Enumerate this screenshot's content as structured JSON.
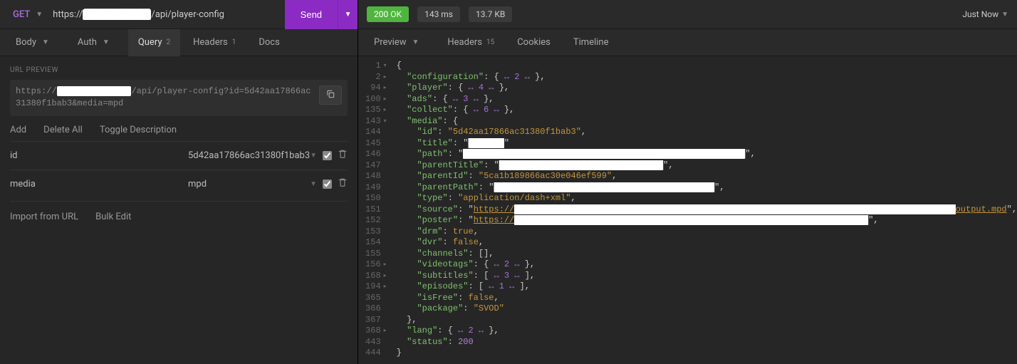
{
  "request": {
    "method": "GET",
    "url_prefix": "https://",
    "url_redacted": "██████████",
    "url_suffix": "/api/player-config",
    "send_label": "Send"
  },
  "req_tabs": {
    "body": "Body",
    "auth": "Auth",
    "query": "Query",
    "query_count": "2",
    "headers": "Headers",
    "headers_count": "1",
    "docs": "Docs"
  },
  "url_preview": {
    "label": "URL PREVIEW",
    "prefix": "https://",
    "redacted": "██████████████",
    "suffix": "/api/player-config?id=5d42aa17866ac31380f1bab3&media=mpd"
  },
  "param_actions": {
    "add": "Add",
    "delete_all": "Delete All",
    "toggle_desc": "Toggle Description"
  },
  "params": [
    {
      "key": "id",
      "value": "5d42aa17866ac31380f1bab3"
    },
    {
      "key": "media",
      "value": "mpd"
    }
  ],
  "footer_actions": {
    "import": "Import from URL",
    "bulk": "Bulk Edit"
  },
  "response": {
    "status_code": "200",
    "status_text": "OK",
    "time": "143 ms",
    "size": "13.7 KB",
    "when": "Just Now"
  },
  "res_tabs": {
    "preview": "Preview",
    "headers": "Headers",
    "headers_count": "15",
    "cookies": "Cookies",
    "timeline": "Timeline"
  },
  "json_lines": [
    {
      "n": "1",
      "f": "v",
      "i": 0,
      "t": [
        {
          "c": "p",
          "v": "{"
        }
      ]
    },
    {
      "n": "2",
      "f": "r",
      "i": 1,
      "t": [
        {
          "c": "k",
          "v": "\"configuration\""
        },
        {
          "c": "p",
          "v": ": { "
        },
        {
          "c": "collapse",
          "v": "↔ 2 ↔"
        },
        {
          "c": "p",
          "v": " },"
        }
      ]
    },
    {
      "n": "94",
      "f": "r",
      "i": 1,
      "t": [
        {
          "c": "k",
          "v": "\"player\""
        },
        {
          "c": "p",
          "v": ": { "
        },
        {
          "c": "collapse",
          "v": "↔ 4 ↔"
        },
        {
          "c": "p",
          "v": " },"
        }
      ]
    },
    {
      "n": "100",
      "f": "r",
      "i": 1,
      "t": [
        {
          "c": "k",
          "v": "\"ads\""
        },
        {
          "c": "p",
          "v": ": { "
        },
        {
          "c": "collapse",
          "v": "↔ 3 ↔"
        },
        {
          "c": "p",
          "v": " },"
        }
      ]
    },
    {
      "n": "135",
      "f": "r",
      "i": 1,
      "t": [
        {
          "c": "k",
          "v": "\"collect\""
        },
        {
          "c": "p",
          "v": ": { "
        },
        {
          "c": "collapse",
          "v": "↔ 6 ↔"
        },
        {
          "c": "p",
          "v": " },"
        }
      ]
    },
    {
      "n": "143",
      "f": "v",
      "i": 1,
      "t": [
        {
          "c": "k",
          "v": "\"media\""
        },
        {
          "c": "p",
          "v": ": {"
        }
      ]
    },
    {
      "n": "144",
      "f": "",
      "i": 2,
      "t": [
        {
          "c": "k",
          "v": "\"id\""
        },
        {
          "c": "p",
          "v": ": "
        },
        {
          "c": "s",
          "v": "\"5d42aa17866ac31380f1bab3\""
        },
        {
          "c": "p",
          "v": ","
        }
      ]
    },
    {
      "n": "145",
      "f": "",
      "i": 2,
      "t": [
        {
          "c": "k",
          "v": "\"title\""
        },
        {
          "c": "p",
          "v": ": \""
        },
        {
          "c": "red",
          "v": "███████"
        },
        {
          "c": "p",
          "v": "\""
        }
      ]
    },
    {
      "n": "146",
      "f": "",
      "i": 2,
      "t": [
        {
          "c": "k",
          "v": "\"path\""
        },
        {
          "c": "p",
          "v": ": \""
        },
        {
          "c": "red",
          "v": "███████████████████████████████████████████████████████"
        },
        {
          "c": "p",
          "v": "\","
        }
      ]
    },
    {
      "n": "147",
      "f": "",
      "i": 2,
      "t": [
        {
          "c": "k",
          "v": "\"parentTitle\""
        },
        {
          "c": "p",
          "v": ": \""
        },
        {
          "c": "red",
          "v": "████████████████████████████████"
        },
        {
          "c": "p",
          "v": "\","
        }
      ]
    },
    {
      "n": "148",
      "f": "",
      "i": 2,
      "t": [
        {
          "c": "k",
          "v": "\"parentId\""
        },
        {
          "c": "p",
          "v": ": "
        },
        {
          "c": "s",
          "v": "\"5ca1b189866ac30e046ef599\""
        },
        {
          "c": "p",
          "v": ","
        }
      ]
    },
    {
      "n": "149",
      "f": "",
      "i": 2,
      "t": [
        {
          "c": "k",
          "v": "\"parentPath\""
        },
        {
          "c": "p",
          "v": ": \""
        },
        {
          "c": "red",
          "v": "███████████████████████████████████████████"
        },
        {
          "c": "p",
          "v": "\","
        }
      ]
    },
    {
      "n": "150",
      "f": "",
      "i": 2,
      "t": [
        {
          "c": "k",
          "v": "\"type\""
        },
        {
          "c": "p",
          "v": ": "
        },
        {
          "c": "s",
          "v": "\"application/dash+xml\""
        },
        {
          "c": "p",
          "v": ","
        }
      ]
    },
    {
      "n": "151",
      "f": "",
      "i": 2,
      "t": [
        {
          "c": "k",
          "v": "\"source\""
        },
        {
          "c": "p",
          "v": ": \""
        },
        {
          "c": "url",
          "v": "https://"
        },
        {
          "c": "red",
          "v": "██████████████████████████████████████████████████████████████████████████████████████"
        },
        {
          "c": "url",
          "v": "output.mpd"
        },
        {
          "c": "p",
          "v": "\","
        }
      ]
    },
    {
      "n": "152",
      "f": "",
      "i": 2,
      "t": [
        {
          "c": "k",
          "v": "\"poster\""
        },
        {
          "c": "p",
          "v": ": \""
        },
        {
          "c": "url",
          "v": "https://"
        },
        {
          "c": "red",
          "v": "█████████████████████████████████████████████████████████████████████"
        },
        {
          "c": "p",
          "v": "\","
        }
      ]
    },
    {
      "n": "153",
      "f": "",
      "i": 2,
      "t": [
        {
          "c": "k",
          "v": "\"drm\""
        },
        {
          "c": "p",
          "v": ": "
        },
        {
          "c": "b",
          "v": "true"
        },
        {
          "c": "p",
          "v": ","
        }
      ]
    },
    {
      "n": "154",
      "f": "",
      "i": 2,
      "t": [
        {
          "c": "k",
          "v": "\"dvr\""
        },
        {
          "c": "p",
          "v": ": "
        },
        {
          "c": "b",
          "v": "false"
        },
        {
          "c": "p",
          "v": ","
        }
      ]
    },
    {
      "n": "155",
      "f": "",
      "i": 2,
      "t": [
        {
          "c": "k",
          "v": "\"channels\""
        },
        {
          "c": "p",
          "v": ": [],"
        }
      ]
    },
    {
      "n": "156",
      "f": "r",
      "i": 2,
      "t": [
        {
          "c": "k",
          "v": "\"videotags\""
        },
        {
          "c": "p",
          "v": ": { "
        },
        {
          "c": "collapse",
          "v": "↔ 2 ↔"
        },
        {
          "c": "p",
          "v": " },"
        }
      ]
    },
    {
      "n": "168",
      "f": "r",
      "i": 2,
      "t": [
        {
          "c": "k",
          "v": "\"subtitles\""
        },
        {
          "c": "p",
          "v": ": [ "
        },
        {
          "c": "collapse",
          "v": "↔ 3 ↔"
        },
        {
          "c": "p",
          "v": " ],"
        }
      ]
    },
    {
      "n": "194",
      "f": "r",
      "i": 2,
      "t": [
        {
          "c": "k",
          "v": "\"episodes\""
        },
        {
          "c": "p",
          "v": ": [ "
        },
        {
          "c": "collapse",
          "v": "↔ 1 ↔"
        },
        {
          "c": "p",
          "v": " ],"
        }
      ]
    },
    {
      "n": "365",
      "f": "",
      "i": 2,
      "t": [
        {
          "c": "k",
          "v": "\"isFree\""
        },
        {
          "c": "p",
          "v": ": "
        },
        {
          "c": "b",
          "v": "false"
        },
        {
          "c": "p",
          "v": ","
        }
      ]
    },
    {
      "n": "366",
      "f": "",
      "i": 2,
      "t": [
        {
          "c": "k",
          "v": "\"package\""
        },
        {
          "c": "p",
          "v": ": "
        },
        {
          "c": "s",
          "v": "\"SVOD\""
        }
      ]
    },
    {
      "n": "367",
      "f": "",
      "i": 1,
      "t": [
        {
          "c": "p",
          "v": "},"
        }
      ]
    },
    {
      "n": "368",
      "f": "r",
      "i": 1,
      "t": [
        {
          "c": "k",
          "v": "\"lang\""
        },
        {
          "c": "p",
          "v": ": { "
        },
        {
          "c": "collapse",
          "v": "↔ 2 ↔"
        },
        {
          "c": "p",
          "v": " },"
        }
      ]
    },
    {
      "n": "443",
      "f": "",
      "i": 1,
      "t": [
        {
          "c": "k",
          "v": "\"status\""
        },
        {
          "c": "p",
          "v": ": "
        },
        {
          "c": "n",
          "v": "200"
        }
      ]
    },
    {
      "n": "444",
      "f": "",
      "i": 0,
      "t": [
        {
          "c": "p",
          "v": "}"
        }
      ]
    }
  ]
}
